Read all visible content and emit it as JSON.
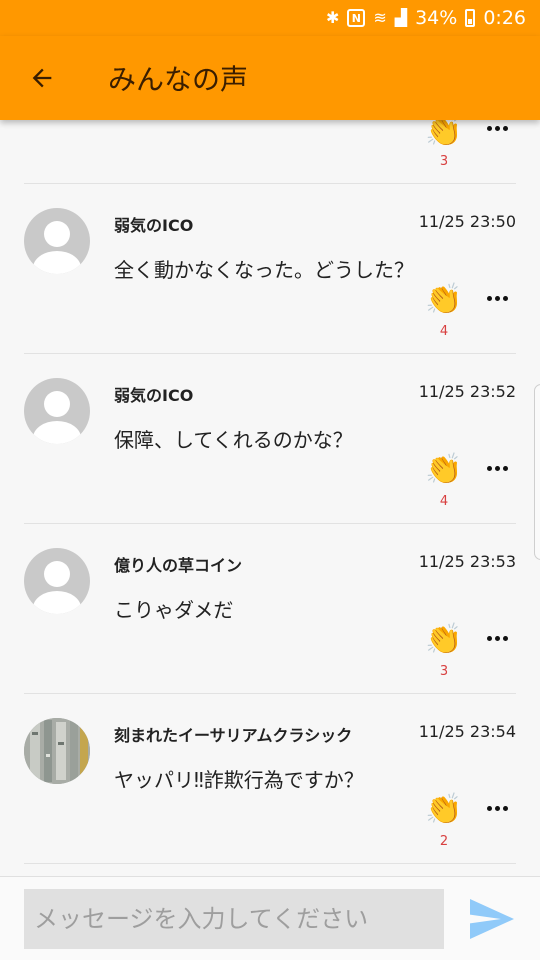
{
  "status_bar": {
    "battery": "34%",
    "time": "0:26"
  },
  "header": {
    "title": "みんなの声"
  },
  "partial_post": {
    "clap_count": "3"
  },
  "posts": [
    {
      "name": "弱気のICO",
      "time": "11/25 23:50",
      "message": "全く動かなくなった。どうした？",
      "clap_count": "4",
      "avatar": "default-avatar"
    },
    {
      "name": "弱気のICO",
      "time": "11/25 23:52",
      "message": "保障、してくれるのかな？",
      "clap_count": "4",
      "avatar": "default-avatar"
    },
    {
      "name": "億り人の草コイン",
      "time": "11/25 23:53",
      "message": "こりゃダメだ",
      "clap_count": "3",
      "avatar": "default-avatar"
    },
    {
      "name": "刻まれたイーサリアムクラシック",
      "time": "11/25 23:54",
      "message": "ヤッパリ‼詐欺行為ですか？",
      "clap_count": "2",
      "avatar": "photo-avatar"
    }
  ],
  "composer": {
    "placeholder": "メッセージを入力してください"
  },
  "colors": {
    "accent": "#ff9800",
    "clap_count": "#d84040",
    "send": "#90caf9"
  },
  "icons": {
    "back": "arrow-left-icon",
    "clap": "clapping-hands-icon",
    "more": "more-horizontal-icon",
    "send": "send-icon"
  }
}
